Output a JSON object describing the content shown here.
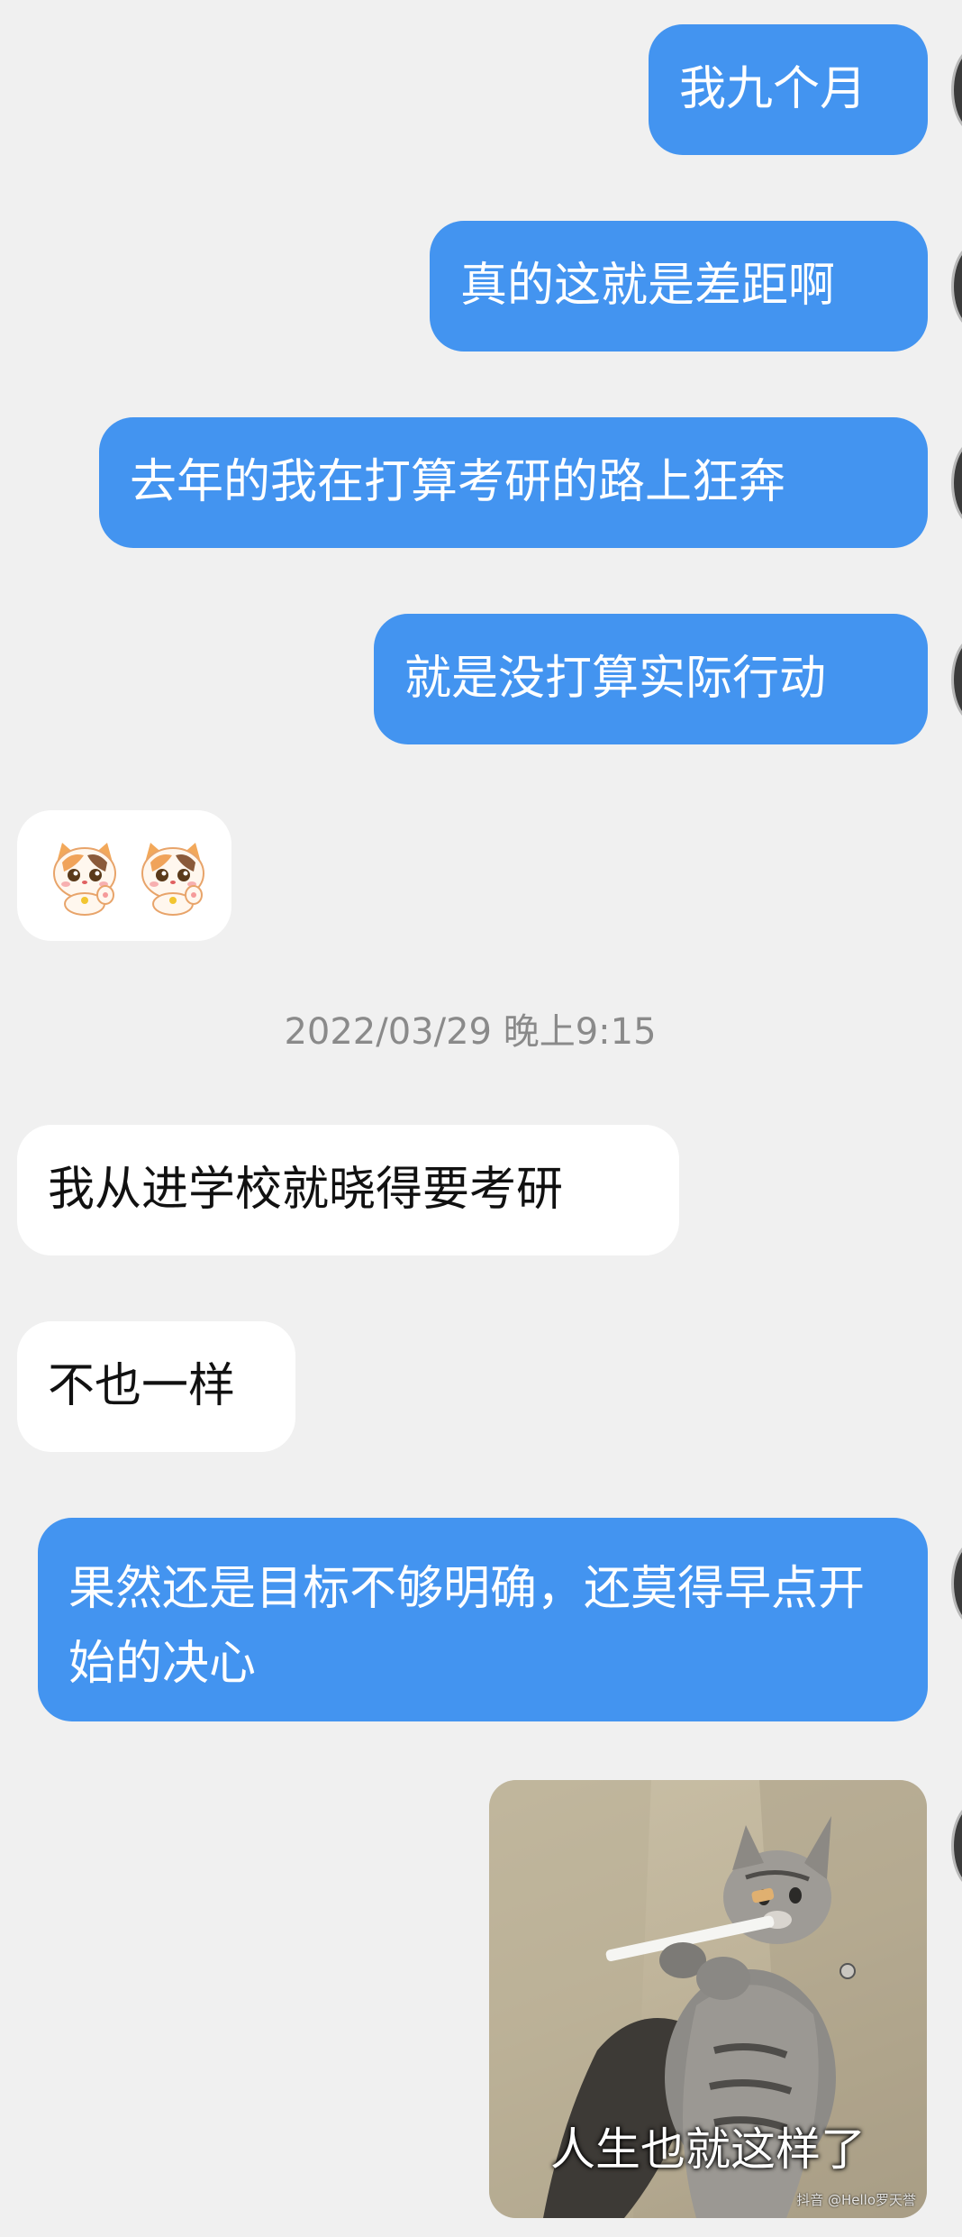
{
  "conversation": {
    "messages": [
      {
        "direction": "out",
        "text": "我九个月"
      },
      {
        "direction": "out",
        "text": "真的这就是差距啊"
      },
      {
        "direction": "out",
        "text": "去年的我在打算考研的路上狂奔"
      },
      {
        "direction": "out",
        "text": "就是没打算实际行动"
      },
      {
        "direction": "in",
        "type": "sticker",
        "icon": "lucky-cat-sticker-icon x2"
      },
      {
        "direction": "in",
        "text": "我从进学校就晓得要考研"
      },
      {
        "direction": "in",
        "text": "不也一样"
      },
      {
        "direction": "out",
        "text": "果然还是目标不够明确，还莫得早点开始的决心"
      },
      {
        "direction": "out",
        "type": "image",
        "caption": "人生也就这样了",
        "watermark": "抖音 @Hello罗天誉"
      }
    ],
    "timestamp": "2022/03/29 晚上9:15"
  },
  "colors": {
    "background": "#f0f0f0",
    "outgoing_bubble": "#4394f0",
    "incoming_bubble": "#ffffff",
    "timestamp_text": "#8a8a8a"
  }
}
